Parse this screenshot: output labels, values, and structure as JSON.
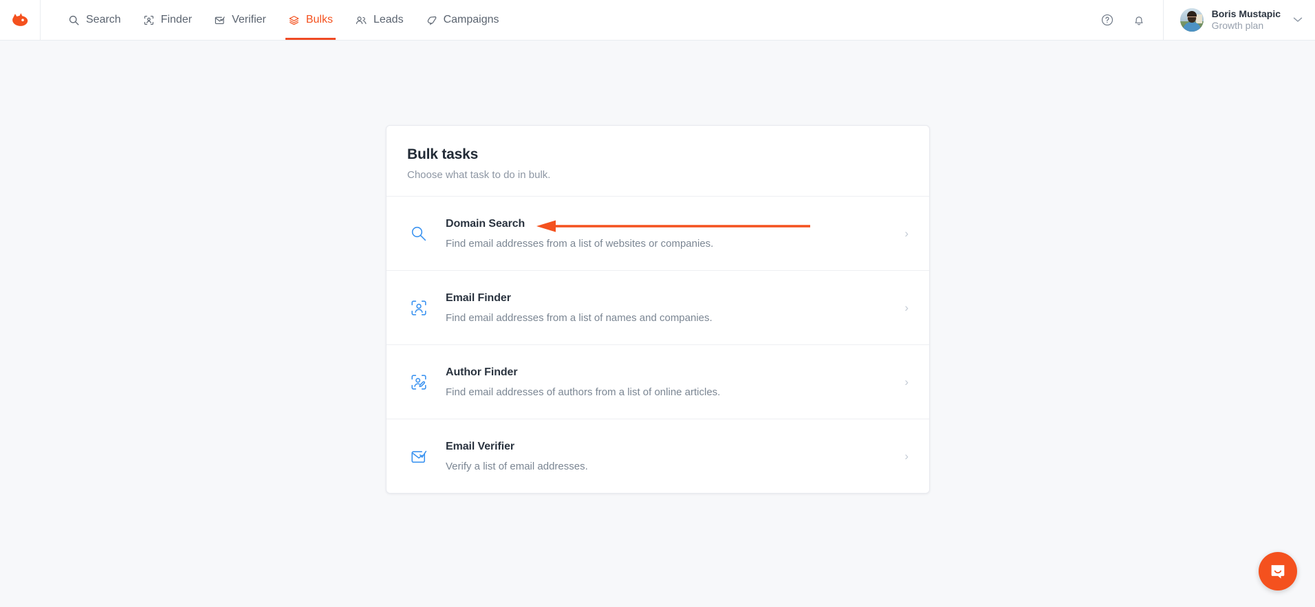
{
  "brand": {
    "logo_icon": "hunter-fox-logo",
    "accent_color": "#f4511e",
    "icon_blue": "#3b93f0"
  },
  "header": {
    "nav": [
      {
        "label": "Search",
        "icon": "search-icon",
        "active": false
      },
      {
        "label": "Finder",
        "icon": "person-scan-icon",
        "active": false
      },
      {
        "label": "Verifier",
        "icon": "envelope-check-icon",
        "active": false
      },
      {
        "label": "Bulks",
        "icon": "layers-icon",
        "active": true
      },
      {
        "label": "Leads",
        "icon": "people-icon",
        "active": false
      },
      {
        "label": "Campaigns",
        "icon": "megaphone-icon",
        "active": false
      }
    ],
    "help_icon": "question-circle-icon",
    "notifications_icon": "bell-icon",
    "user": {
      "name": "Boris Mustapic",
      "plan": "Growth plan",
      "avatar_icon": "user-avatar",
      "caret_icon": "chevron-down-icon"
    }
  },
  "card": {
    "title": "Bulk tasks",
    "subtitle": "Choose what task to do in bulk.",
    "tasks": [
      {
        "name": "Domain Search",
        "description": "Find email addresses from a list of websites or companies.",
        "icon": "magnifier-icon",
        "chevron": "›"
      },
      {
        "name": "Email Finder",
        "description": "Find email addresses from a list of names and companies.",
        "icon": "person-scan-icon",
        "chevron": "›"
      },
      {
        "name": "Author Finder",
        "description": "Find email addresses of authors from a list of online articles.",
        "icon": "person-pen-scan-icon",
        "chevron": "›"
      },
      {
        "name": "Email Verifier",
        "description": "Verify a list of email addresses.",
        "icon": "envelope-check-icon",
        "chevron": "›"
      }
    ]
  },
  "annotation": {
    "arrow_icon": "left-pointing-arrow",
    "color": "#f4511e",
    "points_to": "Domain Search"
  },
  "support": {
    "widget_icon": "intercom-chat-icon",
    "color": "#f4511e"
  }
}
